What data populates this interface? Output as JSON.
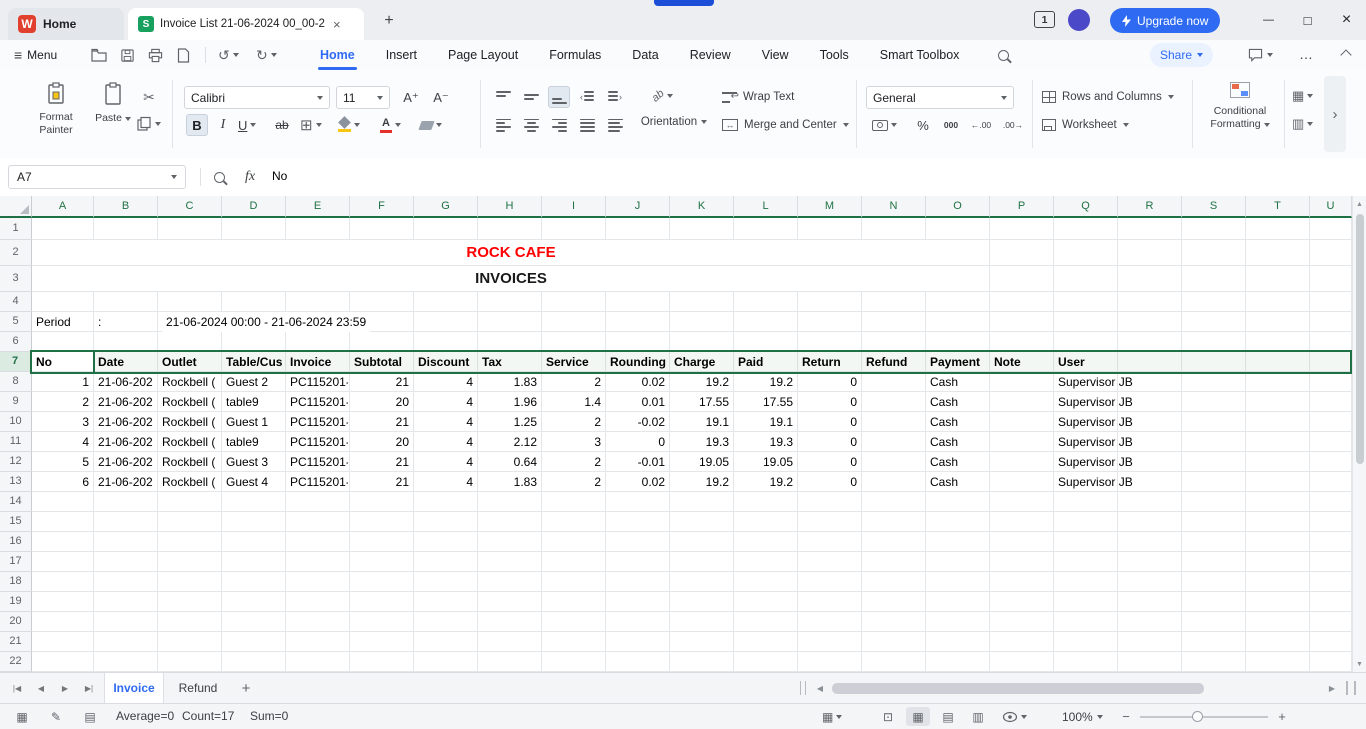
{
  "titlebar": {
    "home_label": "Home",
    "doc_title": "Invoice List 21-06-2024 00_00-2",
    "badge": "1",
    "upgrade_label": "Upgrade now"
  },
  "menubar": {
    "menu_label": "Menu",
    "tabs": [
      "Home",
      "Insert",
      "Page Layout",
      "Formulas",
      "Data",
      "Review",
      "View",
      "Tools",
      "Smart Toolbox"
    ],
    "active_tab": "Home",
    "share_label": "Share"
  },
  "ribbon": {
    "format_painter": "Format Painter",
    "paste": "Paste",
    "font_name": "Calibri",
    "font_size": "11",
    "orientation": "Orientation",
    "wrap_text": "Wrap Text",
    "merge_and_center": "Merge and Center",
    "number_format": "General",
    "rows_and_columns": "Rows and Columns",
    "worksheet": "Worksheet",
    "conditional_line1": "Conditional",
    "conditional_line2": "Formatting"
  },
  "formula_bar": {
    "name_box": "A7",
    "function_label": "fx",
    "content": "No"
  },
  "sheet": {
    "columns": [
      "A",
      "B",
      "C",
      "D",
      "E",
      "F",
      "G",
      "H",
      "I",
      "J",
      "K",
      "L",
      "M",
      "N",
      "O",
      "P",
      "Q",
      "R",
      "S",
      "T",
      "U"
    ],
    "row_numbers": [
      "1",
      "2",
      "3",
      "4",
      "5",
      "6",
      "7",
      "8",
      "9",
      "10",
      "11",
      "12",
      "13",
      "14",
      "15",
      "16",
      "17",
      "18",
      "19",
      "20",
      "21",
      "22"
    ],
    "title": "ROCK CAFE",
    "subtitle": "INVOICES",
    "period_label": "Period",
    "period_colon": ":",
    "period_value": "21-06-2024 00:00 - 21-06-2024 23:59",
    "selected_row": "7",
    "table": {
      "headers": [
        "No",
        "Date",
        "Outlet",
        "Table/Cus",
        "Invoice",
        "Subtotal",
        "Discount",
        "Tax",
        "Service",
        "Rounding",
        "Charge",
        "Paid",
        "Return",
        "Refund",
        "Payment",
        "Note",
        "User"
      ],
      "rows": [
        [
          "1",
          "21-06-202",
          "Rockbell (",
          "Guest 2",
          "PC115201-",
          "21",
          "4",
          "1.83",
          "2",
          "0.02",
          "19.2",
          "19.2",
          "0",
          "",
          "Cash",
          "",
          "Supervisor JB"
        ],
        [
          "2",
          "21-06-202",
          "Rockbell (",
          "table9",
          "PC115201-",
          "20",
          "4",
          "1.96",
          "1.4",
          "0.01",
          "17.55",
          "17.55",
          "0",
          "",
          "Cash",
          "",
          "Supervisor JB"
        ],
        [
          "3",
          "21-06-202",
          "Rockbell (",
          "Guest 1",
          "PC115201-",
          "21",
          "4",
          "1.25",
          "2",
          "-0.02",
          "19.1",
          "19.1",
          "0",
          "",
          "Cash",
          "",
          "Supervisor JB"
        ],
        [
          "4",
          "21-06-202",
          "Rockbell (",
          "table9",
          "PC115201-",
          "20",
          "4",
          "2.12",
          "3",
          "0",
          "19.3",
          "19.3",
          "0",
          "",
          "Cash",
          "",
          "Supervisor JB"
        ],
        [
          "5",
          "21-06-202",
          "Rockbell (",
          "Guest 3",
          "PC115201-",
          "21",
          "4",
          "0.64",
          "2",
          "-0.01",
          "19.05",
          "19.05",
          "0",
          "",
          "Cash",
          "",
          "Supervisor JB"
        ],
        [
          "6",
          "21-06-202",
          "Rockbell (",
          "Guest 4",
          "PC115201-",
          "21",
          "4",
          "1.83",
          "2",
          "0.02",
          "19.2",
          "19.2",
          "0",
          "",
          "Cash",
          "",
          "Supervisor JB"
        ]
      ]
    }
  },
  "sheet_bar": {
    "tabs": [
      "Invoice",
      "Refund"
    ],
    "active_tab": "Invoice"
  },
  "status_bar": {
    "average": "Average=0",
    "count": "Count=17",
    "sum": "Sum=0",
    "zoom_level": "100%"
  },
  "colors": {
    "accent_blue": "#2f6bf2",
    "selection_green": "#1f7145",
    "logo_red": "#e2402e",
    "sheet_green": "#18a05e",
    "title_red": "#ff0000"
  },
  "icons": {
    "menu": "≡",
    "undo": "↺",
    "redo": "↻",
    "scissors": "✂",
    "bold": "B",
    "italic": "I",
    "underline": "U",
    "strikethrough": "ab",
    "borders": "⊞",
    "font_color": "A",
    "font_increase": "A⁺",
    "font_decrease": "A⁻",
    "orientation": "ab",
    "wrap": "↩",
    "merge": "↔",
    "percent": "%",
    "thousands": "000",
    "increase_decimal": "←.00",
    "decrease_decimal": ".00→",
    "fx": "fx",
    "logo": "W",
    "file": "S",
    "more": "›",
    "minimize": "—",
    "maximize": "□",
    "close": "×",
    "plus": "+",
    "ellipsis": "…",
    "zoom_out": "−",
    "zoom_in": "+"
  }
}
